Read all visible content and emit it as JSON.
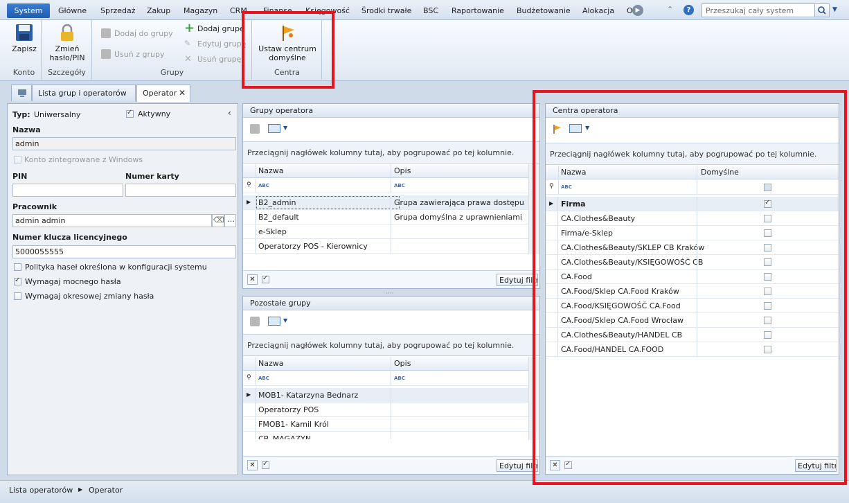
{
  "menu": {
    "items": [
      "System",
      "Główne",
      "Sprzedaż",
      "Zakup",
      "Magazyn",
      "CRM",
      "Finanse",
      "Księgowość",
      "Środki trwałe",
      "BSC",
      "Raportowanie",
      "Budżetowanie",
      "Alokacja",
      "O"
    ],
    "search_placeholder": "Przeszukaj cały system"
  },
  "ribbon": {
    "save": "Zapisz",
    "change_password": [
      "Zmień",
      "hasło/PIN"
    ],
    "add_to_group": "Dodaj do grupy",
    "remove_from_group": "Usuń z grupy",
    "add_group": "Dodaj grupę",
    "edit_group": "Edytuj grupę",
    "delete_group": "Usuń grupę",
    "set_default_center": [
      "Ustaw centrum",
      "domyślne"
    ],
    "group_labels": {
      "konto": "Konto",
      "szczegoly": "Szczegóły",
      "grupy": "Grupy",
      "centra": "Centra"
    }
  },
  "tabs": {
    "list": "Lista grup i operatorów",
    "operator": "Operator"
  },
  "form": {
    "type_label": "Typ:",
    "type_value": "Uniwersalny",
    "active_label": "Aktywny",
    "name_label": "Nazwa",
    "name_value": "admin",
    "windows_label": "Konto zintegrowane z Windows",
    "pin_label": "PIN",
    "card_label": "Numer karty",
    "employee_label": "Pracownik",
    "employee_value": "admin admin",
    "license_label": "Numer klucza licencyjnego",
    "license_value": "5000055555",
    "policy_label": "Polityka haseł określona w konfiguracji systemu",
    "strong_label": "Wymagaj mocnego hasła",
    "periodic_label": "Wymagaj okresowej zmiany hasła"
  },
  "groups_panel": {
    "title": "Grupy operatora",
    "hint": "Przeciągnij nagłówek kolumny tutaj, aby pogrupować po tej kolumnie.",
    "col_name": "Nazwa",
    "col_desc": "Opis",
    "rows": [
      {
        "name": "B2_admin",
        "desc": "Grupa zawierająca prawa dostępu ..."
      },
      {
        "name": "B2_default",
        "desc": "Grupa domyślna z uprawnieniami ..."
      },
      {
        "name": "e-Sklep",
        "desc": ""
      },
      {
        "name": "Operatorzy POS - Kierownicy",
        "desc": ""
      }
    ],
    "edit_filter": "Edytuj filtr"
  },
  "other_panel": {
    "title": "Pozostałe grupy",
    "hint": "Przeciągnij nagłówek kolumny tutaj, aby pogrupować po tej kolumnie.",
    "col_name": "Nazwa",
    "col_desc": "Opis",
    "rows": [
      {
        "name": "MOB1- Katarzyna Bednarz",
        "desc": ""
      },
      {
        "name": "Operatorzy POS",
        "desc": ""
      },
      {
        "name": "FMOB1- Kamil Król",
        "desc": ""
      },
      {
        "name": "CB_MAGAZYN",
        "desc": ""
      }
    ],
    "edit_filter": "Edytuj filtr"
  },
  "centers_panel": {
    "title": "Centra operatora",
    "hint": "Przeciągnij nagłówek kolumny tutaj, aby pogrupować po tej kolumnie.",
    "col_name": "Nazwa",
    "col_default": "Domyślne",
    "rows": [
      {
        "name": "Firma",
        "default": true
      },
      {
        "name": "CA.Clothes&Beauty",
        "default": false
      },
      {
        "name": "Firma/e-Sklep",
        "default": false
      },
      {
        "name": "CA.Clothes&Beauty/SKLEP CB Kraków",
        "default": false
      },
      {
        "name": "CA.Clothes&Beauty/KSIĘGOWOŚĆ CB",
        "default": false
      },
      {
        "name": "CA.Food",
        "default": false
      },
      {
        "name": "CA.Food/Sklep CA.Food Kraków",
        "default": false
      },
      {
        "name": "CA.Food/KSIĘGOWOŚĆ CA.Food",
        "default": false
      },
      {
        "name": "CA.Food/Sklep CA.Food Wrocław",
        "default": false
      },
      {
        "name": "CA.Clothes&Beauty/HANDEL CB",
        "default": false
      },
      {
        "name": "CA.Food/HANDEL CA.FOOD",
        "default": false
      }
    ],
    "edit_filter": "Edytuj filtr"
  },
  "status": {
    "crumb1": "Lista operatorów",
    "crumb2": "Operator"
  },
  "colors": {
    "highlight": "#e8141d",
    "accent": "#1d5eb6"
  }
}
